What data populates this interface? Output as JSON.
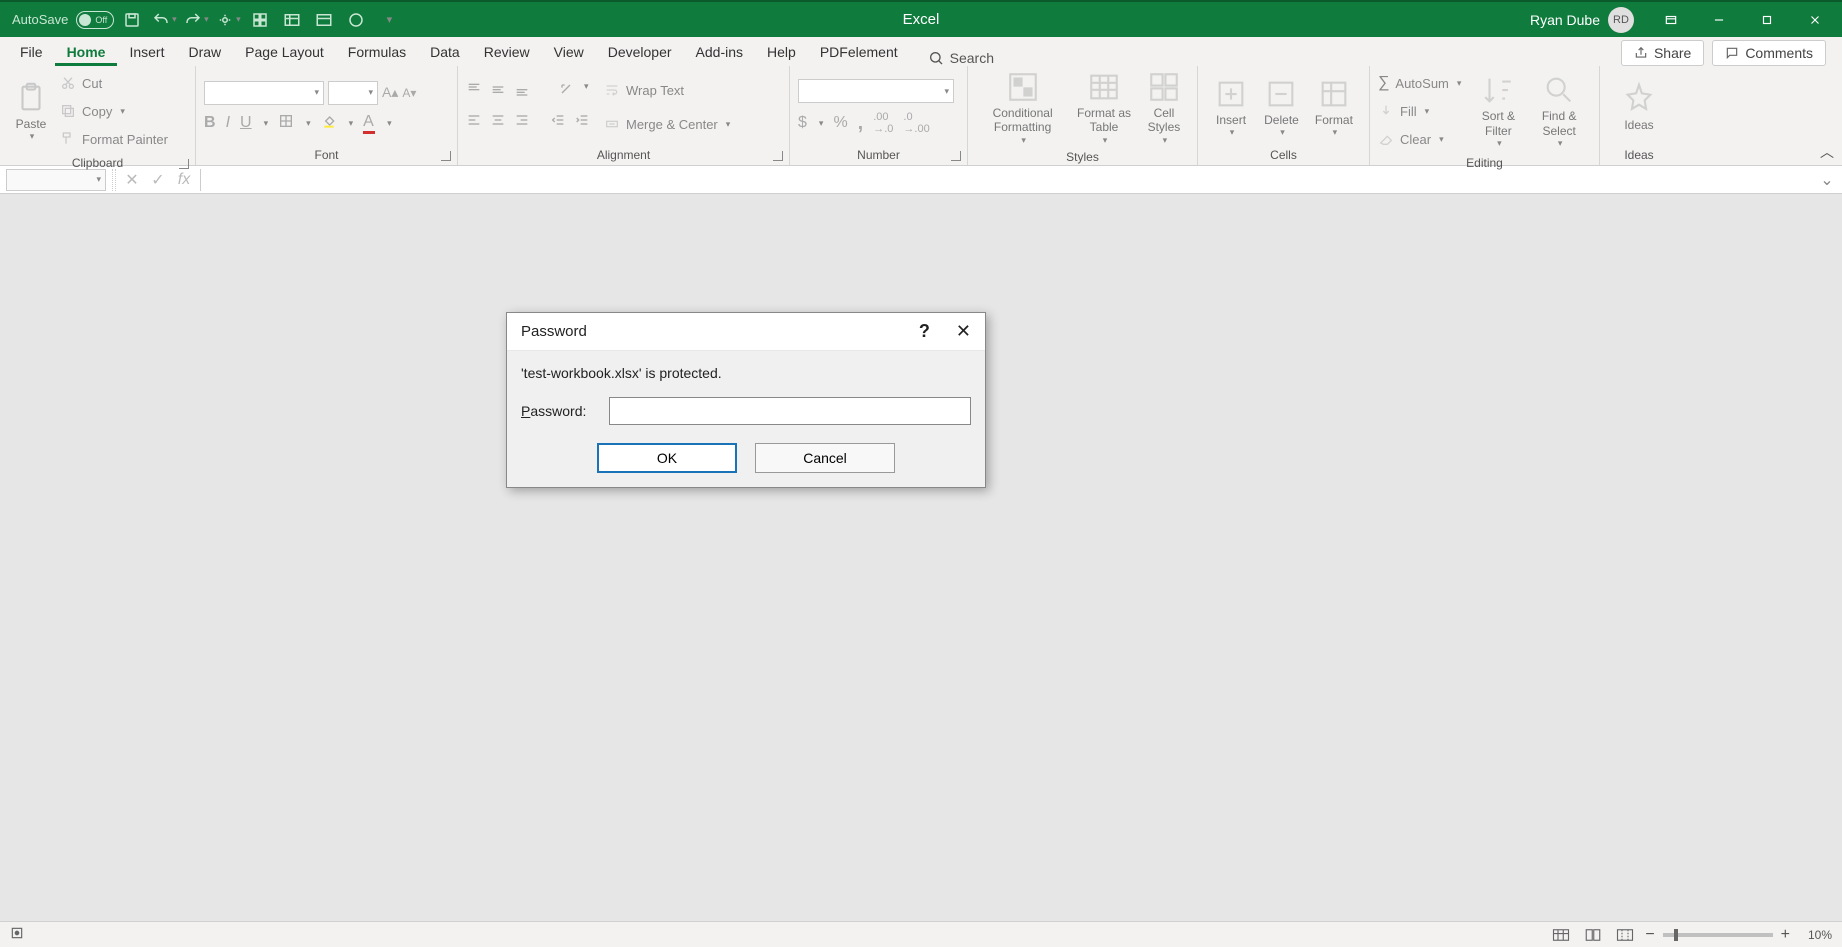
{
  "titlebar": {
    "autosave_label": "AutoSave",
    "autosave_state": "Off",
    "app_name": "Excel",
    "user_name": "Ryan Dube",
    "user_initials": "RD"
  },
  "tabs": {
    "items": [
      "File",
      "Home",
      "Insert",
      "Draw",
      "Page Layout",
      "Formulas",
      "Data",
      "Review",
      "View",
      "Developer",
      "Add-ins",
      "Help",
      "PDFelement"
    ],
    "active": "Home",
    "search_placeholder": "Search",
    "share_label": "Share",
    "comments_label": "Comments"
  },
  "ribbon": {
    "clipboard": {
      "label": "Clipboard",
      "paste": "Paste",
      "cut": "Cut",
      "copy": "Copy",
      "format_painter": "Format Painter"
    },
    "font": {
      "label": "Font"
    },
    "alignment": {
      "label": "Alignment",
      "wrap": "Wrap Text",
      "merge": "Merge & Center"
    },
    "number": {
      "label": "Number"
    },
    "styles": {
      "label": "Styles",
      "cond": "Conditional Formatting",
      "table": "Format as Table",
      "cell": "Cell Styles"
    },
    "cells": {
      "label": "Cells",
      "insert": "Insert",
      "delete": "Delete",
      "format": "Format"
    },
    "editing": {
      "label": "Editing",
      "autosum": "AutoSum",
      "fill": "Fill",
      "clear": "Clear",
      "sort": "Sort & Filter",
      "find": "Find & Select"
    },
    "ideas": {
      "label": "Ideas",
      "btn": "Ideas"
    }
  },
  "dialog": {
    "title": "Password",
    "message": "'test-workbook.xlsx' is protected.",
    "label": "Password:",
    "ok": "OK",
    "cancel": "Cancel"
  },
  "statusbar": {
    "zoom": "10%"
  }
}
